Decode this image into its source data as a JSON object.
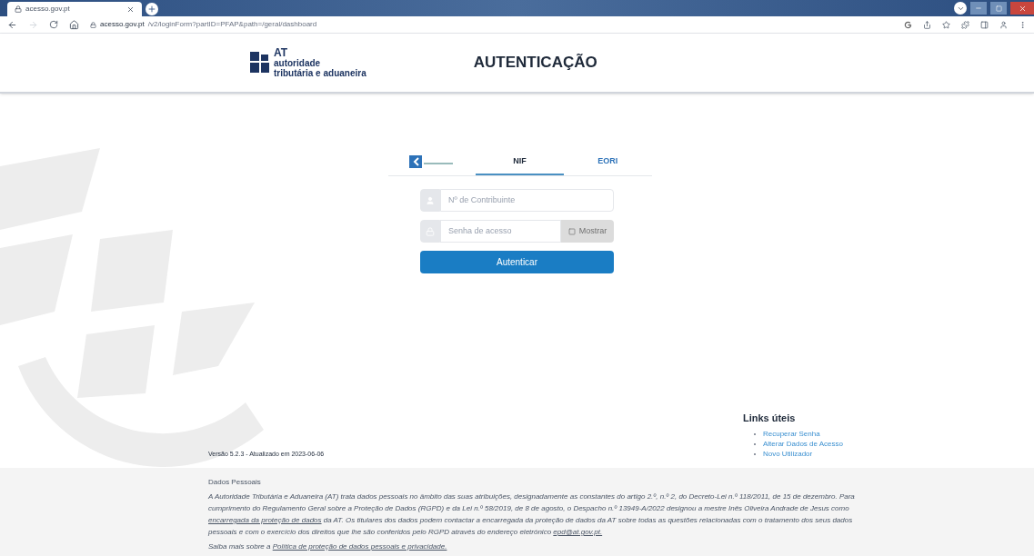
{
  "browser": {
    "tab_title": "acesso.gov.pt",
    "url_host": "acesso.gov.pt",
    "url_path": "/v2/loginForm?partID=PFAP&path=/geral/dashboard"
  },
  "header": {
    "logo_lines": [
      "AT",
      "autoridade",
      "tributária e aduaneira"
    ],
    "title": "AUTENTICAÇÃO"
  },
  "login_tabs": [
    {
      "kind": "logo",
      "selected": false
    },
    {
      "kind": "text",
      "label": "NIF",
      "selected": true
    },
    {
      "kind": "text",
      "label": "EORI",
      "selected": false
    }
  ],
  "fields": [
    {
      "kind": "user",
      "placeholder": "Nº de Contribuinte"
    },
    {
      "kind": "password",
      "placeholder": "Senha de acesso",
      "toggle": {
        "label": "Mostrar",
        "disabled": true
      }
    }
  ],
  "submit": "Autenticar",
  "version": "Versão 5.2.3 - Atualizado em 2023-06-06",
  "links": {
    "title": "Links úteis",
    "items": [
      "Recuperar Senha",
      "Alterar Dados de Acesso",
      "Novo Utilizador"
    ]
  },
  "footer": {
    "title": "Dados Pessoais",
    "paragraphs": [
      [
        {
          "kind": "text",
          "text": "A Autoridade Tributária e Aduaneira (AT) trata dados pessoais no âmbito das suas atribuições, designadamente as constantes do artigo 2.º, n.º 2, do Decreto-Lei n.º 118/2011, de 15 de dezembro. Para cumprimento do Regulamento Geral sobre a Proteção de Dados (RGPD) e da Lei n.º 58/2019, de 8 de agosto, o Despacho n.º 13949-A/2022 designou a mestre Inês Oliveira Andrade de Jesus como"
        },
        {
          "kind": "link",
          "text": "encarregada da proteção de dados"
        },
        {
          "kind": "text",
          "text": "da AT. Os titulares dos dados podem contactar a encarregada da proteção de dados da AT sobre todas as questões relacionadas com o tratamento dos seus dados pessoais e com o exercício dos direitos que lhe são conferidos pelo RGPD através do endereço eletrónico"
        },
        {
          "kind": "link",
          "text": "epd@at.gov.pt."
        }
      ],
      [
        {
          "kind": "text",
          "text": "Saiba mais sobre a"
        },
        {
          "kind": "link",
          "text": "Política de proteção de dados pessoais e privacidade."
        }
      ]
    ]
  }
}
